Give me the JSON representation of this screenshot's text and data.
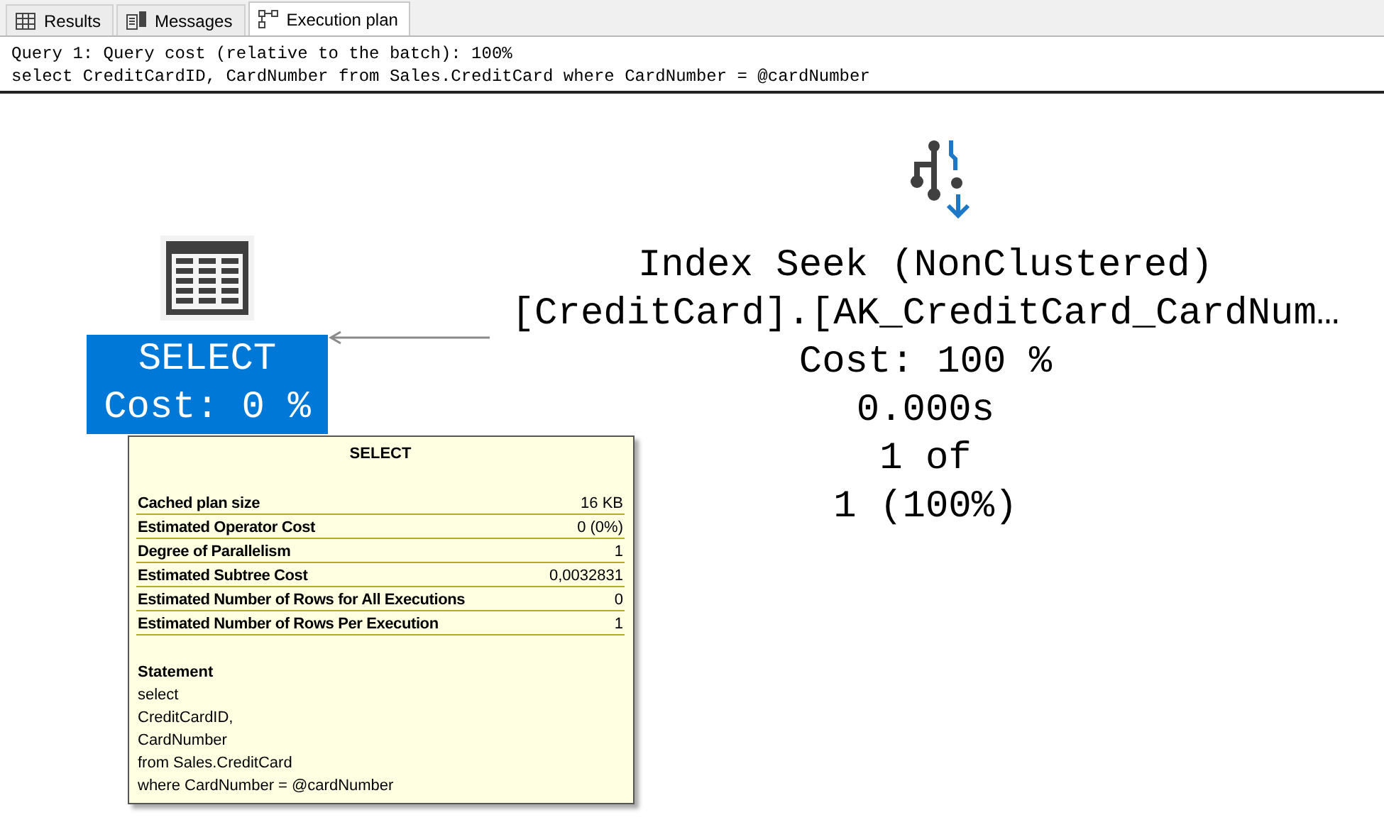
{
  "tabs": [
    {
      "label": "Results",
      "selected": false
    },
    {
      "label": "Messages",
      "selected": false
    },
    {
      "label": "Execution plan",
      "selected": true
    }
  ],
  "query_header": [
    "Query 1: Query cost (relative to the batch): 100%",
    "select CreditCardID, CardNumber from Sales.CreditCard where CardNumber = @cardNumber"
  ],
  "plan_nodes": [
    {
      "kind": "select",
      "selected": true,
      "lines": [
        "SELECT",
        "Cost: 0 %"
      ]
    },
    {
      "kind": "index_seek",
      "selected": false,
      "lines": [
        "Index Seek (NonClustered)",
        "[CreditCard].[AK_CreditCard_CardNum…",
        "Cost: 100 %",
        "0.000s",
        "1 of",
        "1 (100%)"
      ]
    }
  ],
  "tooltip": {
    "title": "SELECT",
    "properties": [
      {
        "label": "Cached plan size",
        "value": "16 KB"
      },
      {
        "label": "Estimated Operator Cost",
        "value": "0 (0%)"
      },
      {
        "label": "Degree of Parallelism",
        "value": "1"
      },
      {
        "label": "Estimated Subtree Cost",
        "value": "0,0032831"
      },
      {
        "label": "Estimated Number of Rows for All Executions",
        "value": "0"
      },
      {
        "label": "Estimated Number of Rows Per Execution",
        "value": "1"
      }
    ],
    "statement_label": "Statement",
    "statement_lines": [
      "select",
      "CreditCardID,",
      "CardNumber",
      "from Sales.CreditCard",
      "where CardNumber = @cardNumber"
    ]
  }
}
